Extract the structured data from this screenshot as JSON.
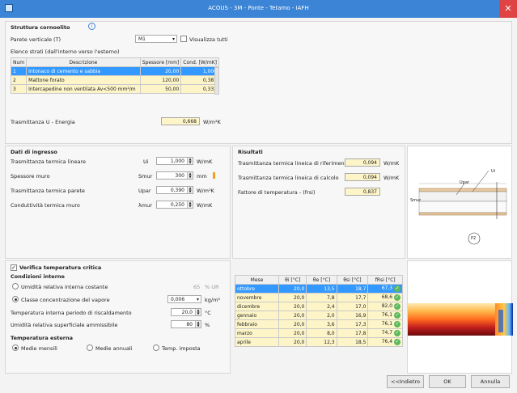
{
  "window": {
    "title": "ACOUS - 3M - Ponte - Tetamo - IAFH"
  },
  "struttura": {
    "title": "Struttura cornoolito",
    "parete_label": "Parete verticale (T)",
    "parete_value": "M1",
    "visualizza_label": "Visualizza tutti",
    "strati_label": "Elenco strati (dall'interno verso l'esterno)",
    "columns": [
      "Num",
      "Descrizione",
      "Spessore [mm]",
      "Cond. [W/mK]"
    ],
    "rows": [
      {
        "num": "1",
        "desc": "Intonaco di cemento e sabbia",
        "thick": "20,00",
        "cond": "1,000"
      },
      {
        "num": "2",
        "desc": "Mattone forato",
        "thick": "120,00",
        "cond": "0,387"
      },
      {
        "num": "3",
        "desc": "Intercapedine non ventilata Av<500 mm²/m",
        "thick": "50,00",
        "cond": "0,333"
      }
    ],
    "trasmittanza_label": "Trasmittanza U - Energia",
    "trasmittanza_value": "0,668",
    "trasmittanza_unit": "W/m²K"
  },
  "dati": {
    "title": "Dati di ingresso",
    "rows": [
      {
        "label": "Trasmittanza termica lineare",
        "sym": "Ui",
        "value": "1,000",
        "unit": "W/mK"
      },
      {
        "label": "Spessore muro",
        "sym": "Smur",
        "value": "300",
        "unit": "mm"
      },
      {
        "label": "Trasmittanza termica parete",
        "sym": "Upar",
        "value": "0,390",
        "unit": "W/m²K"
      },
      {
        "label": "Conduttività termica muro",
        "sym": "λmur",
        "value": "0,250",
        "unit": "W/mK"
      }
    ]
  },
  "risultati": {
    "title": "Risultati",
    "rows": [
      {
        "label": "Trasmittanza termica lineica di riferimento",
        "value": "0,094",
        "unit": "W/mK"
      },
      {
        "label": "Trasmittanza termica lineica di calcolo",
        "value": "0,094",
        "unit": "W/mK"
      },
      {
        "label": "Fattore di temperatura - (frsi)",
        "value": "0,837",
        "unit": ""
      }
    ]
  },
  "verifica": {
    "checkbox_label": "Verifica temperatura critica",
    "condizioni_title": "Condizioni interne",
    "option1_label": "Umidità relativa interna costante",
    "option1_value": "65",
    "option1_unit": "% UR",
    "option2_label": "Classe concentrazione del vapore",
    "option2_value": "0,006",
    "option2_unit": "kg/m³",
    "temp_label": "Temperatura interna periodo di riscaldamento",
    "temp_value": "20,0",
    "temp_unit": "°C",
    "umid_label": "Umidità relativa superficiale ammissibile",
    "umid_value": "80",
    "umid_unit": "%",
    "esterna_title": "Temperatura esterna",
    "radio_a": "Medie mensili",
    "radio_b": "Medie annuali",
    "radio_c": "Temp. imposta"
  },
  "mesi": {
    "columns": [
      "Mese",
      "θi [°C]",
      "θe [°C]",
      "θsi [°C]",
      "fRsi [°C]"
    ],
    "rows": [
      {
        "mese": "ottobre",
        "ti": "20,0",
        "te": "13,5",
        "tsi": "18,7",
        "fr": "67,3"
      },
      {
        "mese": "novembre",
        "ti": "20,0",
        "te": "7,8",
        "tsi": "17,7",
        "fr": "68,6"
      },
      {
        "mese": "dicembre",
        "ti": "20,0",
        "te": "2,4",
        "tsi": "17,0",
        "fr": "82,0"
      },
      {
        "mese": "gennaio",
        "ti": "20,0",
        "te": "2,0",
        "tsi": "16,9",
        "fr": "76,1"
      },
      {
        "mese": "febbraio",
        "ti": "20,0",
        "te": "3,6",
        "tsi": "17,3",
        "fr": "76,1"
      },
      {
        "mese": "marzo",
        "ti": "20,0",
        "te": "8,0",
        "tsi": "17,8",
        "fr": "74,7"
      },
      {
        "mese": "aprile",
        "ti": "20,0",
        "te": "12,3",
        "tsi": "18,5",
        "fr": "76,4"
      }
    ]
  },
  "diagram": {
    "detail_label": "P2",
    "lab1": "Ui",
    "lab2": "Upar",
    "lab3": "Smur"
  },
  "buttons": {
    "back": "<<Indietro",
    "ok": "OK",
    "cancel": "Annulla"
  },
  "colors": {
    "titlebar": "#3c84d6",
    "selected": "#3399ff",
    "yellow": "#fdf5c8"
  }
}
